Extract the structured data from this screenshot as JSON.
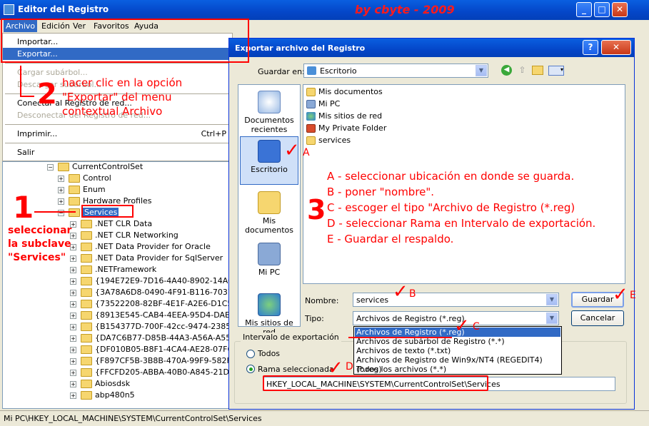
{
  "app": {
    "title": "Editor del Registro",
    "watermark": "by cbyte  - 2009",
    "min": "_",
    "max": "□",
    "close": "✕"
  },
  "menubar": {
    "archivo": "Archivo",
    "edicion": "Edición",
    "ver": "Ver",
    "favoritos": "Favoritos",
    "ayuda": "Ayuda"
  },
  "archivo_menu": {
    "importar": "Importar...",
    "exportar": "Exportar...",
    "cargar": "Cargar subárbol...",
    "descargar": "Descargar subárbol...",
    "conectar": "Conectar al Registro de red...",
    "desconectar": "Desconectar del Registro de red...",
    "imprimir": "Imprimir...",
    "imprimir_sc": "Ctrl+P",
    "salir": "Salir"
  },
  "tree": {
    "currentcontrolset": "CurrentControlSet",
    "items_top": [
      "Control",
      "Enum",
      "Hardware Profiles"
    ],
    "services": "Services",
    "children": [
      ".NET CLR Data",
      ".NET CLR Networking",
      ".NET Data Provider for Oracle",
      ".NET Data Provider for SqlServer",
      ".NETFramework",
      "{194E72E9-7D16-4A40-8902-14AC33E",
      "{3A78A6D8-0490-4F91-B116-7037366",
      "{73522208-82BF-4E1F-A2E6-D1C56B7",
      "{8913E545-CAB4-4EEA-95D4-DAB74F",
      "{B154377D-700F-42cc-9474-23858FB",
      "{DA7C6B77-D85B-44A3-A56A-A55C7C",
      "{DF010B05-B8F1-4CA4-AE28-07F6218",
      "{F897CF5B-3B8B-470A-99F9-582F726",
      "{FFCFD205-ABBA-40B0-A845-21DCC8",
      "Abiosdsk",
      "abp480n5"
    ]
  },
  "statusbar": "Mi PC\\HKEY_LOCAL_MACHINE\\SYSTEM\\CurrentControlSet\\Services",
  "dialog": {
    "title": "Exportar archivo del Registro",
    "help": "?",
    "close": "✕",
    "guardar_en_label": "Guardar en:",
    "guardar_en_value": "Escritorio",
    "places": [
      "Documentos recientes",
      "Escritorio",
      "Mis documentos",
      "Mi PC",
      "Mis sitios de red"
    ],
    "files": [
      "Mis documentos",
      "Mi PC",
      "Mis sitios de red",
      "My Private Folder",
      "services"
    ],
    "nombre_label": "Nombre:",
    "nombre_value": "services",
    "tipo_label": "Tipo:",
    "tipo_value": "Archivos de Registro (*.reg)",
    "tipo_options": [
      "Archivos de Registro (*.reg)",
      "Archivos de subárbol de Registro (*.*)",
      "Archivos de texto (*.txt)",
      "Archivos de Registro de Win9x/NT4 (REGEDIT4) (*.reg)",
      "Todos los archivos (*.*)"
    ],
    "guardar_btn": "Guardar",
    "cancelar_btn": "Cancelar",
    "intervalo_legend": "Intervalo de exportación",
    "todos": "Todos",
    "rama": "Rama seleccionada",
    "rama_path": "HKEY_LOCAL_MACHINE\\SYSTEM\\CurrentControlSet\\Services"
  },
  "annotations": {
    "step2_num": "2",
    "step2_text": [
      "hacer clic en la opción",
      "\"Exportar\" del menu",
      "contextual Archivo"
    ],
    "step1_num": "1",
    "step1_text": [
      "seleccionar",
      "la subclave",
      "\"Services\""
    ],
    "step3_num": "3",
    "step3_lines": [
      "A - seleccionar ubicación en donde se guarda.",
      "B - poner \"nombre\".",
      "C - escoger el tipo \"Archivo de Registro (*.reg)",
      "D - seleccionar Rama en Intervalo de exportación.",
      "E - Guardar el respaldo."
    ],
    "A": "A",
    "B": "B",
    "C": "C",
    "D": "D",
    "E": "E",
    "check": "✓"
  },
  "colors": {
    "accent": "#316ac5",
    "annotation": "#ff0000",
    "titlebar": "#0446c8"
  }
}
